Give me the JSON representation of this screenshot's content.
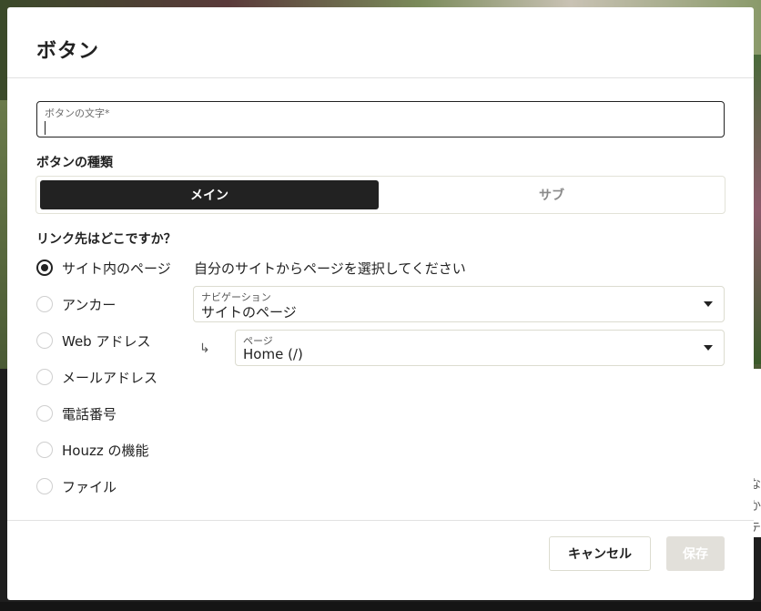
{
  "dialog": {
    "title": "ボタン",
    "text_field": {
      "label": "ボタンの文字*",
      "value": ""
    },
    "type_section": {
      "label": "ボタンの種類",
      "options": [
        {
          "label": "メイン",
          "selected": true
        },
        {
          "label": "サブ",
          "selected": false
        }
      ]
    },
    "link_section": {
      "label": "リンク先はどこですか？",
      "options": [
        {
          "label": "サイト内のページ",
          "selected": true
        },
        {
          "label": "アンカー",
          "selected": false
        },
        {
          "label": "Web アドレス",
          "selected": false
        },
        {
          "label": "メールアドレス",
          "selected": false
        },
        {
          "label": "電話番号",
          "selected": false
        },
        {
          "label": "Houzz の機能",
          "selected": false
        },
        {
          "label": "ファイル",
          "selected": false
        }
      ],
      "helper": "自分のサイトからページを選択してください",
      "navigation_select": {
        "label": "ナビゲーション",
        "value": "サイトのページ"
      },
      "page_select": {
        "label": "ページ",
        "value": "Home (/)"
      }
    },
    "footer": {
      "cancel_label": "キャンセル",
      "save_label": "保存"
    }
  },
  "background": {
    "edge_chars": [
      "な",
      "か",
      "テ"
    ]
  },
  "colors": {
    "primary": "#222222",
    "disabled": "#e2e0da",
    "border": "#dcdcd0"
  },
  "icons": {
    "dropdown": "chevron-down-icon",
    "subitem": "subdirectory-arrow-icon"
  }
}
